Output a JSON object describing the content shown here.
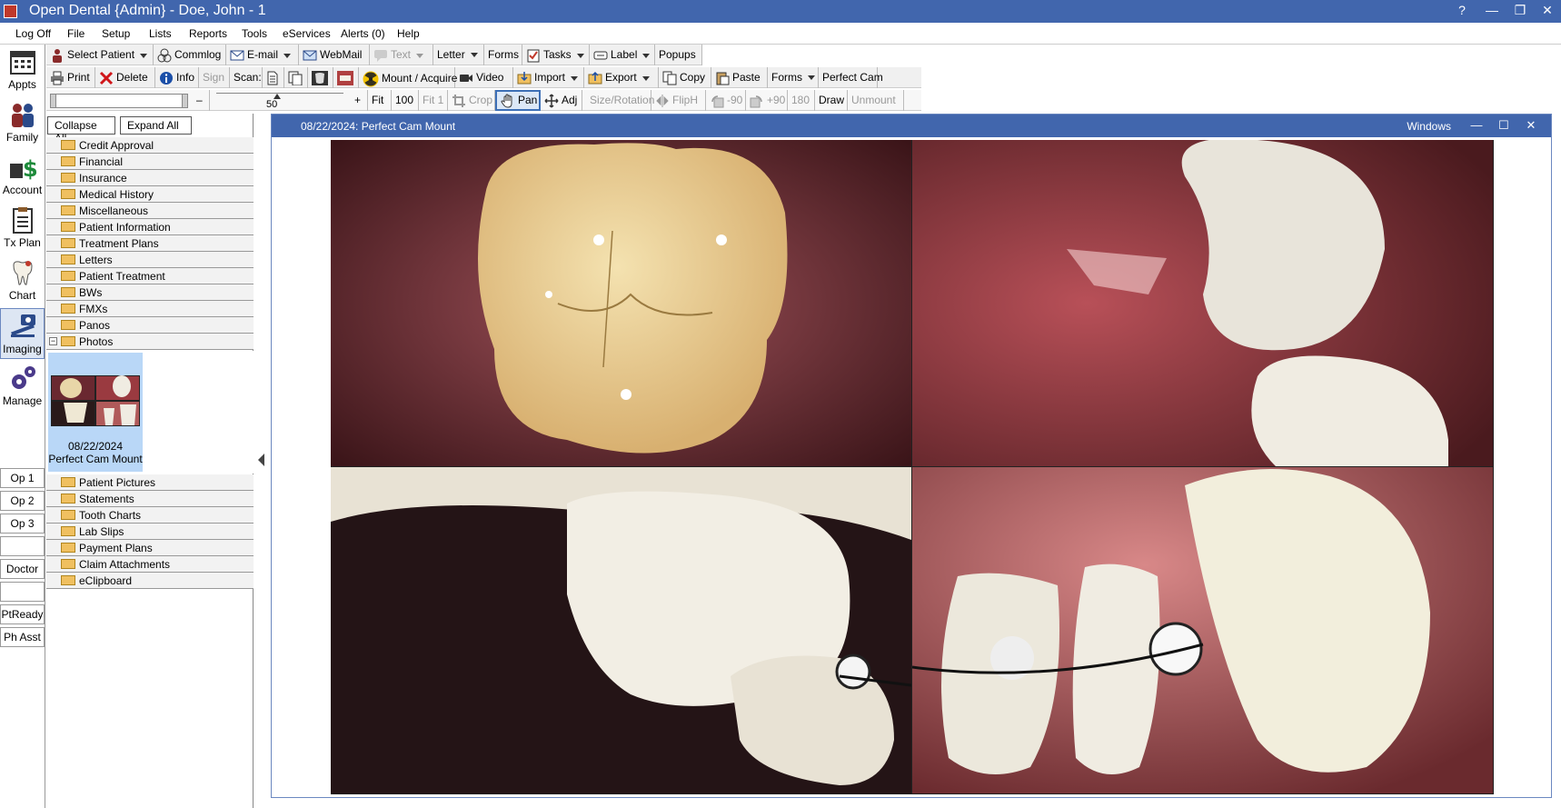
{
  "app": {
    "title": "Open Dental {Admin} - Doe, John - 1",
    "controls": [
      "?",
      "—",
      "❐",
      "✕"
    ]
  },
  "menu": [
    "Log Off",
    "File",
    "Setup",
    "Lists",
    "Reports",
    "Tools",
    "eServices",
    "Alerts (0)",
    "Help"
  ],
  "modules": [
    "Appts",
    "Family",
    "Account",
    "Tx Plan",
    "Chart",
    "Imaging",
    "Manage"
  ],
  "ops": [
    "Op 1",
    "Op 2",
    "Op 3",
    "",
    "Doctor",
    "",
    "PtReady",
    "Ph Asst"
  ],
  "toolbar1": {
    "select_patient": "Select Patient",
    "commlog": "Commlog",
    "email": "E-mail",
    "webmail": "WebMail",
    "text": "Text",
    "letter": "Letter",
    "forms": "Forms",
    "tasks": "Tasks",
    "label": "Label",
    "popups": "Popups"
  },
  "toolbar2": {
    "print": "Print",
    "delete": "Delete",
    "info": "Info",
    "sign": "Sign",
    "scan": "Scan:",
    "mount_acquire": "Mount / Acquire",
    "video": "Video",
    "import": "Import",
    "export": "Export",
    "copy": "Copy",
    "paste": "Paste",
    "forms": "Forms",
    "perfect_cam": "Perfect Cam"
  },
  "toolbar3": {
    "minus": "–",
    "zoom_value": "50",
    "plus": "+",
    "fit": "Fit",
    "hundred": "100",
    "fit1": "Fit 1",
    "crop": "Crop",
    "pan": "Pan",
    "adj": "Adj",
    "size_rotation": "Size/Rotation",
    "fliph": "FlipH",
    "minus90": "-90",
    "plus90": "+90",
    "r180": "180",
    "draw": "Draw",
    "unmount": "Unmount"
  },
  "tree": {
    "collapse_all": "Collapse All",
    "expand_all": "Expand All",
    "folders_top": [
      "Credit Approval",
      "Financial",
      "Insurance",
      "Medical History",
      "Miscellaneous",
      "Patient Information",
      "Treatment Plans",
      "Letters",
      "Patient Treatment",
      "BWs",
      "FMXs",
      "Panos",
      "Photos"
    ],
    "folders_bottom": [
      "Patient Pictures",
      "Statements",
      "Tooth Charts",
      "Lab Slips",
      "Payment Plans",
      "Claim Attachments",
      "eClipboard"
    ],
    "thumb": {
      "date": "08/22/2024",
      "name": "Perfect Cam Mount"
    }
  },
  "mount_window": {
    "title": "08/22/2024: Perfect Cam Mount",
    "windows_label": "Windows",
    "controls": [
      "—",
      "☐",
      "✕"
    ]
  },
  "colors": {
    "titlebar": "#4166ad",
    "selected": "#b9d7f7"
  }
}
